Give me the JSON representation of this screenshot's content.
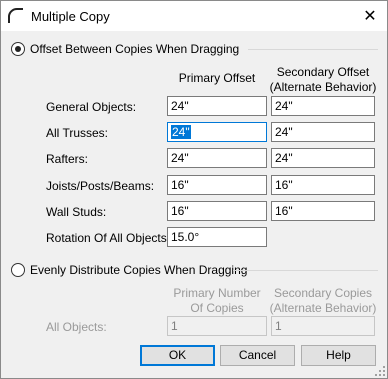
{
  "window": {
    "title": "Multiple Copy",
    "close_glyph": "✕"
  },
  "offset_section": {
    "label": "Offset Between Copies When Dragging",
    "selected": true,
    "primary_header": "Primary Offset",
    "secondary_header_line1": "Secondary Offset",
    "secondary_header_line2": "(Alternate Behavior)",
    "rows": [
      {
        "label": "General Objects:",
        "primary": "24\"",
        "secondary": "24\""
      },
      {
        "label": "All Trusses:",
        "primary": "24\"",
        "secondary": "24\""
      },
      {
        "label": "Rafters:",
        "primary": "24\"",
        "secondary": "24\""
      },
      {
        "label": "Joists/Posts/Beams:",
        "primary": "16\"",
        "secondary": "16\""
      },
      {
        "label": "Wall Studs:",
        "primary": "16\"",
        "secondary": "16\""
      }
    ],
    "rotation": {
      "label": "Rotation Of All Objects:",
      "value": "15.0°"
    }
  },
  "distribute_section": {
    "label": "Evenly Distribute Copies When Dragging",
    "selected": false,
    "primary_header_line1": "Primary Number",
    "primary_header_line2": "Of Copies",
    "secondary_header_line1": "Secondary Copies",
    "secondary_header_line2": "(Alternate Behavior)",
    "row": {
      "label": "All Objects:",
      "primary": "1",
      "secondary": "1"
    }
  },
  "buttons": {
    "ok": "OK",
    "cancel": "Cancel",
    "help": "Help"
  },
  "colors": {
    "accent": "#0078d7",
    "disabled_text": "#9a9a9a",
    "background": "#f0f0f0"
  },
  "icons": {
    "app": "arc-icon",
    "close": "close-icon",
    "grip": "resize-grip-icon"
  }
}
